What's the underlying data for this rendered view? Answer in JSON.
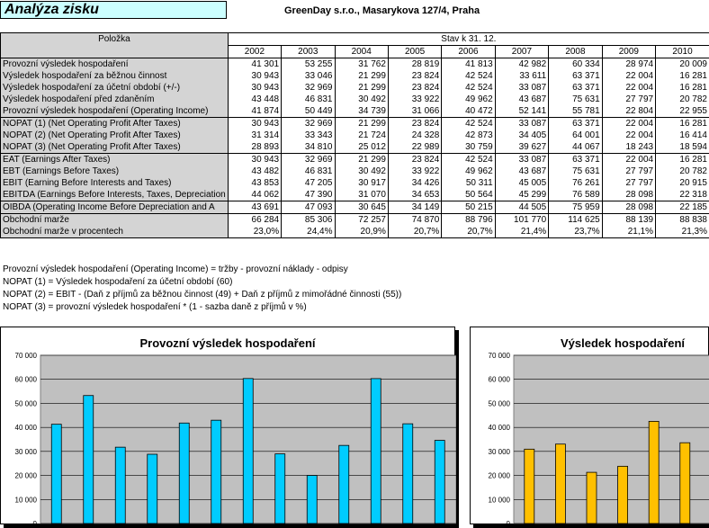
{
  "header": {
    "title": "Analýza zisku",
    "company": "GreenDay s.r.o., Masarykova 127/4, Praha"
  },
  "table": {
    "item_header": "Položka",
    "stav_header": "Stav  k  31. 12.",
    "years": [
      "2002",
      "2003",
      "2004",
      "2005",
      "2006",
      "2007",
      "2008",
      "2009",
      "2010"
    ],
    "groups": [
      [
        {
          "label": "Provozní výsledek hospodaření",
          "values": [
            "41 301",
            "53 255",
            "31 762",
            "28 819",
            "41 813",
            "42 982",
            "60 334",
            "28 974",
            "20 009"
          ]
        },
        {
          "label": "Výsledek hospodaření za běžnou činnost",
          "values": [
            "30 943",
            "33 046",
            "21 299",
            "23 824",
            "42 524",
            "33 611",
            "63 371",
            "22 004",
            "16 281"
          ]
        },
        {
          "label": "Výsledek hospodaření za účetní období (+/-)",
          "values": [
            "30 943",
            "32 969",
            "21 299",
            "23 824",
            "42 524",
            "33 087",
            "63 371",
            "22 004",
            "16 281"
          ]
        },
        {
          "label": "Výsledek hospodaření před zdaněním",
          "values": [
            "43 448",
            "46 831",
            "30 492",
            "33 922",
            "49 962",
            "43 687",
            "75 631",
            "27 797",
            "20 782"
          ]
        },
        {
          "label": "Provozní výsledek hospodaření (Operating Income)",
          "values": [
            "41 874",
            "50 449",
            "34 739",
            "31 066",
            "40 472",
            "52 141",
            "55 781",
            "22 804",
            "22 955"
          ]
        }
      ],
      [
        {
          "label": "NOPAT (1) (Net Operating Profit After Taxes)",
          "values": [
            "30 943",
            "32 969",
            "21 299",
            "23 824",
            "42 524",
            "33 087",
            "63 371",
            "22 004",
            "16 281"
          ]
        },
        {
          "label": "NOPAT (2) (Net Operating Profit After Taxes)",
          "values": [
            "31 314",
            "33 343",
            "21 724",
            "24 328",
            "42 873",
            "34 405",
            "64 001",
            "22 004",
            "16 414"
          ]
        },
        {
          "label": "NOPAT (3) (Net Operating Profit After Taxes)",
          "values": [
            "28 893",
            "34 810",
            "25 012",
            "22 989",
            "30 759",
            "39 627",
            "44 067",
            "18 243",
            "18 594"
          ]
        }
      ],
      [
        {
          "label": "EAT (Earnings After Taxes)",
          "values": [
            "30 943",
            "32 969",
            "21 299",
            "23 824",
            "42 524",
            "33 087",
            "63 371",
            "22 004",
            "16 281"
          ]
        },
        {
          "label": "EBT (Earnings Before Taxes)",
          "values": [
            "43 482",
            "46 831",
            "30 492",
            "33 922",
            "49 962",
            "43 687",
            "75 631",
            "27 797",
            "20 782"
          ]
        },
        {
          "label": "EBIT (Earning Before Interests and Taxes)",
          "values": [
            "43 853",
            "47 205",
            "30 917",
            "34 426",
            "50 311",
            "45 005",
            "76 261",
            "27 797",
            "20 915"
          ]
        },
        {
          "label": "EBITDA (Earnings Before Interests, Taxes, Depreciation",
          "values": [
            "44 062",
            "47 390",
            "31 070",
            "34 653",
            "50 564",
            "45 299",
            "76 589",
            "28 098",
            "22 318"
          ]
        }
      ],
      [
        {
          "label": "OIBDA (Operating Income Before Depreciation and A",
          "values": [
            "43 691",
            "47 093",
            "30 645",
            "34 149",
            "50 215",
            "44 505",
            "75 959",
            "28 098",
            "22 185"
          ]
        }
      ],
      [
        {
          "label": "Obchodní marže",
          "values": [
            "66 284",
            "85 306",
            "72 257",
            "74 870",
            "88 796",
            "101 770",
            "114 625",
            "88 139",
            "88 838"
          ]
        },
        {
          "label": "Obchodní marže v procentech",
          "values": [
            "23,0%",
            "24,4%",
            "20,9%",
            "20,7%",
            "20,7%",
            "21,4%",
            "23,7%",
            "21,1%",
            "21,3%"
          ]
        }
      ]
    ]
  },
  "notes": [
    "Provozní výsledek hospodaření (Operating Income) = tržby - provozní náklady - odpisy",
    "NOPAT (1) = Výsledek hospodaření za účetní období (60)",
    "NOPAT (2) = EBIT - (Daň z příjmů za běžnou činnost (49) + Daň z příjmů z mimořádné činnosti (55))",
    "NOPAT (3) = provozní výsledek hospodaření * (1 - sazba daně z příjmů v %)"
  ],
  "colors": {
    "label_bg": "#d4d4d4",
    "title_bg": "#ccffff",
    "plot_bg": "#c0c0c0",
    "chart1_bar": "#00ccff",
    "chart2_bar": "#ffc000"
  },
  "chart_data": [
    {
      "type": "bar",
      "title": "Provozní výsledek hospodaření",
      "ylim": [
        0,
        70000
      ],
      "yticks": [
        "0",
        "10 000",
        "20 000",
        "30 000",
        "40 000",
        "50 000",
        "60 000",
        "70 000"
      ],
      "values": [
        41301,
        53255,
        31762,
        28819,
        41813,
        42982,
        60334,
        28974,
        20009,
        32500,
        60300,
        41500,
        34600
      ],
      "grid": true,
      "color": "#00ccff"
    },
    {
      "type": "bar",
      "title": "Výsledek hospodaření",
      "ylim": [
        0,
        70000
      ],
      "yticks": [
        "0",
        "10 000",
        "20 000",
        "30 000",
        "40 000",
        "50 000",
        "60 000",
        "70 000"
      ],
      "values": [
        30943,
        33046,
        21299,
        23824,
        42524,
        33611
      ],
      "grid": true,
      "color": "#ffc000"
    }
  ]
}
